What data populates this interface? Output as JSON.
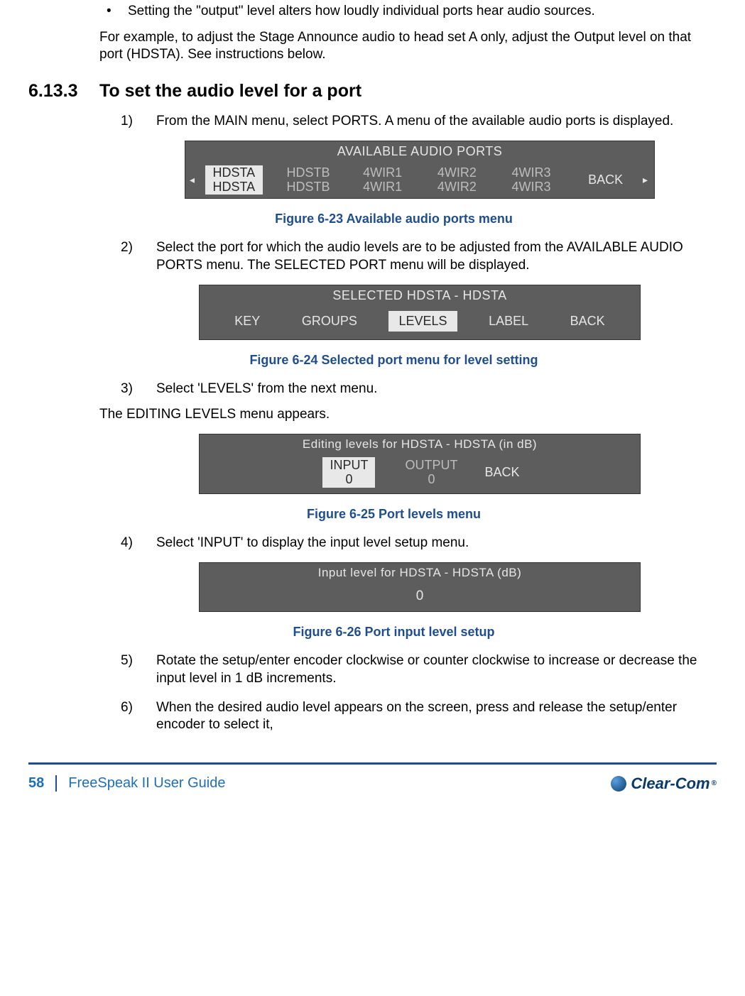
{
  "intro": {
    "bullet": "Setting the \"output\" level alters how loudly individual ports hear audio sources.",
    "example": "For example, to adjust the Stage Announce audio to head set A only, adjust the Output level on that port (HDSTA). See instructions below."
  },
  "section": {
    "number": "6.13.3",
    "title": "To set the audio level for a port"
  },
  "steps": [
    "From the MAIN menu, select PORTS. A menu of the available audio ports is displayed.",
    "Select the port for which the audio levels are to be adjusted from the AVAILABLE AUDIO PORTS menu. The SELECTED PORT menu will be displayed.",
    "Select 'LEVELS' from the next menu.",
    "Select 'INPUT' to display the input level setup menu.",
    "Rotate the setup/enter encoder clockwise or counter clockwise to increase or decrease the input level in 1 dB increments.",
    "When the desired audio level appears on the screen, press and release the setup/enter encoder to select it,"
  ],
  "after_step3": "The EDITING LEVELS menu appears.",
  "captions": {
    "c1": "Figure 6-23 Available audio ports menu",
    "c2": "Figure 6-24 Selected port menu for level setting",
    "c3": "Figure 6-25 Port levels menu",
    "c4": "Figure 6-26 Port input level setup"
  },
  "lcd_ports": {
    "title": "AVAILABLE AUDIO PORTS",
    "row1": [
      "HDSTA",
      "HDSTB",
      "4WIR1",
      "4WIR2",
      "4WIR3"
    ],
    "row2": [
      "HDSTA",
      "HDSTB",
      "4WIR1",
      "4WIR2",
      "4WIR3"
    ],
    "back": "BACK"
  },
  "lcd_selected": {
    "title": "SELECTED HDSTA - HDSTA",
    "items": [
      "KEY",
      "GROUPS",
      "LEVELS",
      "LABEL",
      "BACK"
    ]
  },
  "lcd_levels": {
    "title": "Editing levels for HDSTA - HDSTA (in dB)",
    "input_label": "INPUT",
    "output_label": "OUTPUT",
    "input_val": "0",
    "output_val": "0",
    "back": "BACK"
  },
  "lcd_input": {
    "title": "Input level for HDSTA - HDSTA (dB)",
    "value": "0"
  },
  "footer": {
    "page": "58",
    "title": "FreeSpeak II User Guide",
    "brand": "Clear-Com",
    "reg": "®"
  }
}
